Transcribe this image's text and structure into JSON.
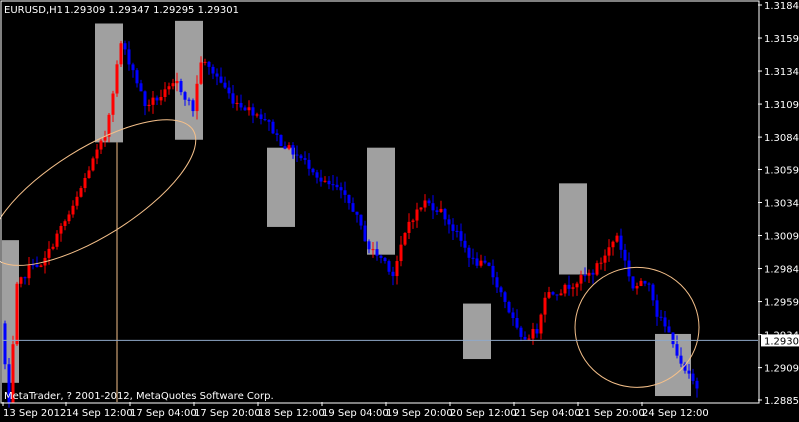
{
  "header": {
    "symbol_timeframe": "EURUSD,H1",
    "ohlc": "1.29309 1.29347 1.29295 1.29301"
  },
  "footer": {
    "copyright": "MetaTrader, ? 2001-2012, MetaQuotes Software Corp."
  },
  "colors": {
    "background": "#000000",
    "frame": "#ffffff",
    "bull": "#ff0000",
    "bear": "#0000ff",
    "zone": "#a0a0a0",
    "ellipse": "#f5c08a",
    "bid_line": "#8fa8c8"
  },
  "chart_data": {
    "type": "candlestick",
    "price_axis": {
      "labels": [
        "1.31840",
        "1.31590",
        "1.31340",
        "1.31090",
        "1.30840",
        "1.30595",
        "1.30345",
        "1.30095",
        "1.29845",
        "1.29595",
        "1.29345",
        "1.29095",
        "1.28850"
      ],
      "values": [
        1.3184,
        1.3159,
        1.3134,
        1.3109,
        1.3084,
        1.30595,
        1.30345,
        1.30095,
        1.29845,
        1.29595,
        1.29345,
        1.29095,
        1.2885
      ]
    },
    "time_axis": {
      "labels": [
        "13 Sep 2012",
        "14 Sep 12:00",
        "17 Sep 04:00",
        "17 Sep 20:00",
        "18 Sep 12:00",
        "19 Sep 04:00",
        "19 Sep 20:00",
        "20 Sep 12:00",
        "21 Sep 04:00",
        "21 Sep 20:00",
        "24 Sep 12:00"
      ]
    },
    "current_price": {
      "value": 1.29301,
      "label": "1.29301"
    },
    "ylim": [
      1.2885,
      1.3184
    ],
    "candle_count": 141,
    "anchors": [
      [
        0,
        1.2943
      ],
      [
        2,
        1.288
      ],
      [
        4,
        1.297
      ],
      [
        8,
        1.299
      ],
      [
        10,
        1.2985
      ],
      [
        14,
        1.301
      ],
      [
        18,
        1.303
      ],
      [
        22,
        1.306
      ],
      [
        26,
        1.3085
      ],
      [
        28,
        1.312
      ],
      [
        30,
        1.3155
      ],
      [
        33,
        1.3135
      ],
      [
        36,
        1.3108
      ],
      [
        40,
        1.3115
      ],
      [
        44,
        1.3125
      ],
      [
        48,
        1.3105
      ],
      [
        50,
        1.3142
      ],
      [
        54,
        1.313
      ],
      [
        58,
        1.3112
      ],
      [
        62,
        1.3105
      ],
      [
        66,
        1.3098
      ],
      [
        70,
        1.308
      ],
      [
        74,
        1.307
      ],
      [
        78,
        1.306
      ],
      [
        80,
        1.305
      ],
      [
        84,
        1.3045
      ],
      [
        88,
        1.303
      ],
      [
        92,
        1.3
      ],
      [
        96,
        1.299
      ],
      [
        98,
        1.298
      ],
      [
        102,
        1.302
      ],
      [
        106,
        1.3035
      ],
      [
        110,
        1.3028
      ],
      [
        114,
        1.301
      ],
      [
        118,
        1.299
      ],
      [
        122,
        1.2985
      ],
      [
        126,
        1.296
      ],
      [
        130,
        1.293
      ],
      [
        134,
        1.2938
      ],
      [
        136,
        1.2965
      ],
      [
        140,
        1.2968
      ],
      [
        144,
        1.2975
      ],
      [
        148,
        1.2982
      ],
      [
        150,
        1.299
      ],
      [
        154,
        1.301
      ],
      [
        158,
        1.297
      ],
      [
        162,
        1.2975
      ],
      [
        164,
        1.295
      ],
      [
        168,
        1.293
      ],
      [
        170,
        1.291
      ],
      [
        174,
        1.2895
      ],
      [
        178,
        1.2905
      ],
      [
        182,
        1.293
      ],
      [
        185,
        1.293
      ]
    ],
    "rectangles": [
      {
        "name": "zone-1",
        "t0": -1.0,
        "t1": 3.5,
        "hi": 1.3006,
        "lo": 1.2898
      },
      {
        "name": "zone-2",
        "t0": 22.5,
        "t1": 29.5,
        "hi": 1.317,
        "lo": 1.308
      },
      {
        "name": "zone-3",
        "t0": 42.5,
        "t1": 49.5,
        "hi": 1.3172,
        "lo": 1.3082
      },
      {
        "name": "zone-4",
        "t0": 65.5,
        "t1": 72.5,
        "hi": 1.3076,
        "lo": 1.3016
      },
      {
        "name": "zone-5",
        "t0": 90.5,
        "t1": 97.5,
        "hi": 1.3076,
        "lo": 1.2995
      },
      {
        "name": "zone-6",
        "t0": 114.5,
        "t1": 121.5,
        "hi": 1.2958,
        "lo": 1.2916
      },
      {
        "name": "zone-7",
        "t0": 138.5,
        "t1": 145.5,
        "hi": 1.3049,
        "lo": 1.298
      },
      {
        "name": "zone-8",
        "t0": 162.5,
        "t1": 171.5,
        "hi": 1.2935,
        "lo": 1.2888
      }
    ],
    "vertical_marker": {
      "t": 28.0
    },
    "ellipses": [
      {
        "name": "ellipse-left",
        "center_t": 22.0,
        "center_p": 1.3042,
        "angle_deg": -32
      },
      {
        "name": "ellipse-right",
        "center_t": 158.0,
        "center_p": 1.294
      }
    ]
  }
}
